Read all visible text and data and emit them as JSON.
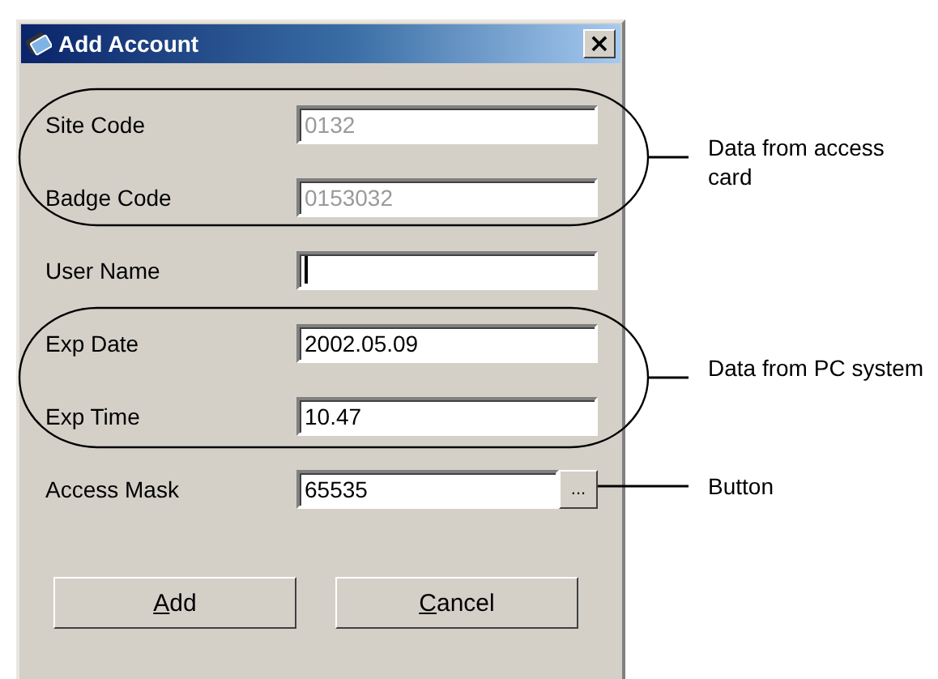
{
  "window": {
    "title": "Add Account",
    "close_label": "×"
  },
  "fields": [
    {
      "label": "Site Code",
      "value": "0132",
      "kind": "text",
      "disabled": true,
      "focused": false
    },
    {
      "label": "Badge Code",
      "value": "0153032",
      "kind": "text",
      "disabled": true,
      "focused": false
    },
    {
      "label": "User Name",
      "kind": "text",
      "disabled": false,
      "focused": true
    },
    {
      "label": "Exp Date",
      "value": "2002.05.09",
      "kind": "text",
      "disabled": false,
      "focused": false
    },
    {
      "label": "Exp Time",
      "value": "10.47",
      "kind": "text",
      "disabled": false,
      "focused": false
    },
    {
      "label": "Access Mask",
      "value": "65535",
      "kind": "browse",
      "button_label": "...",
      "disabled": false,
      "focused": false
    }
  ],
  "buttons": [
    {
      "access_key": "A",
      "label_rest": "dd"
    },
    {
      "access_key": "C",
      "label_rest": "ancel"
    }
  ],
  "annotations": [
    {
      "kind": "group",
      "text": "Data from access card"
    },
    {
      "kind": "group",
      "text": "Data from PC system"
    },
    {
      "kind": "pointer",
      "text": "Button"
    }
  ]
}
